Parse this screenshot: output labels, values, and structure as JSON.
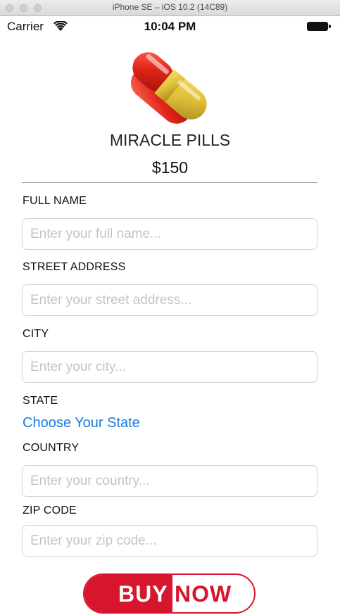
{
  "window": {
    "title": "iPhone SE – iOS 10.2 (14C89)"
  },
  "status_bar": {
    "carrier": "Carrier",
    "time": "10:04 PM",
    "wifi_icon": "wifi-icon",
    "battery_icon": "battery-icon"
  },
  "product": {
    "image_icon": "pill-capsule-icon",
    "name": "MIRACLE PILLS",
    "price": "$150"
  },
  "form": {
    "full_name": {
      "label": "FULL NAME",
      "value": "",
      "placeholder": "Enter your full name..."
    },
    "street_address": {
      "label": "STREET ADDRESS",
      "value": "",
      "placeholder": "Enter your street address..."
    },
    "city": {
      "label": "CITY",
      "value": "",
      "placeholder": "Enter your city..."
    },
    "state": {
      "label": "STATE",
      "link": "Choose Your State"
    },
    "country": {
      "label": "COUNTRY",
      "value": "",
      "placeholder": "Enter your country..."
    },
    "zip_code": {
      "label": "ZIP CODE",
      "value": "",
      "placeholder": "Enter your zip code..."
    }
  },
  "buy_button": {
    "left_text": "BUY",
    "right_text": "NOW"
  },
  "colors": {
    "accent_red": "#d6162d",
    "link_blue": "#1a7ae2",
    "pill_red": "#d82a1c",
    "pill_yellow": "#e3c23a"
  }
}
